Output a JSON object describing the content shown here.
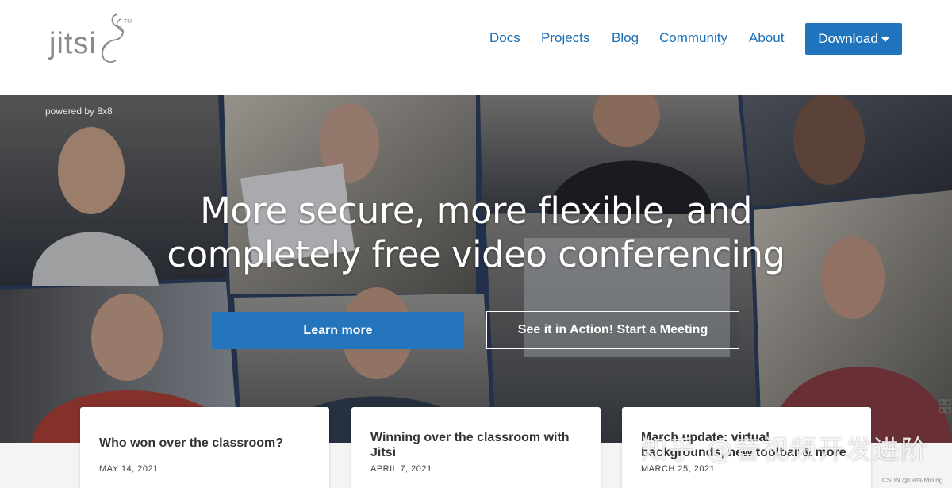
{
  "header": {
    "logo_text": "jitsi",
    "logo_tm": "TM",
    "nav": [
      "Docs",
      "Projects",
      "Blog",
      "Community",
      "About"
    ],
    "download_label": "Download"
  },
  "hero": {
    "powered_by": "powered by 8x8",
    "title_line1": "More secure, more flexible, and",
    "title_line2": "completely free video conferencing",
    "learn_more": "Learn more",
    "action": "See it in Action! Start a Meeting"
  },
  "cards": [
    {
      "title": "Who won over the classroom?",
      "date": "MAY 14, 2021"
    },
    {
      "title": "Winning over the classroom with Jitsi",
      "date": "APRIL 7, 2021"
    },
    {
      "title": "March update: virtual backgrounds, new toolbar & more",
      "date": "MARCH 25, 2021"
    }
  ],
  "watermark": {
    "text": "知乎 @音视频开发进阶",
    "csdn": "CSDN @Data-Mining"
  },
  "colors": {
    "link": "#1a6fb5",
    "button": "#1f74bd",
    "learn_button": "#2575bd"
  },
  "icons": [
    "caret-down-icon",
    "grid-icon"
  ]
}
